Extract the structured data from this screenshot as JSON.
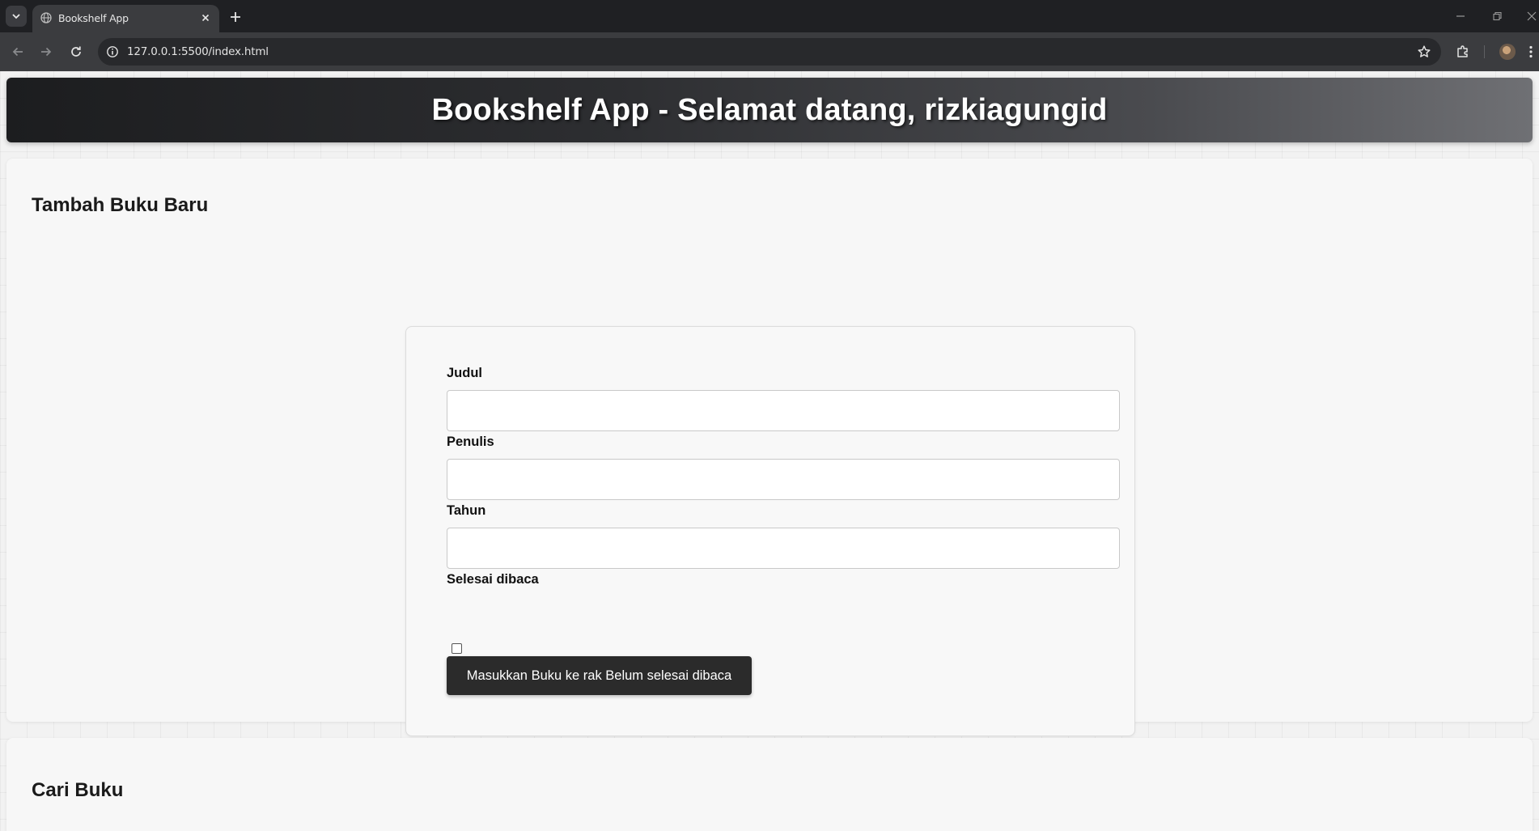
{
  "browser": {
    "tab_title": "Bookshelf App",
    "url": "127.0.0.1:5500/index.html"
  },
  "header": {
    "title": "Bookshelf App - Selamat datang, rizkiagungid"
  },
  "add_book": {
    "heading": "Tambah Buku Baru",
    "title_label": "Judul",
    "title_value": "",
    "author_label": "Penulis",
    "author_value": "",
    "year_label": "Tahun",
    "year_value": "",
    "complete_label": "Selesai dibaca",
    "complete_checked": false,
    "submit_label": "Masukkan Buku ke rak Belum selesai dibaca"
  },
  "search_book": {
    "heading": "Cari Buku"
  }
}
